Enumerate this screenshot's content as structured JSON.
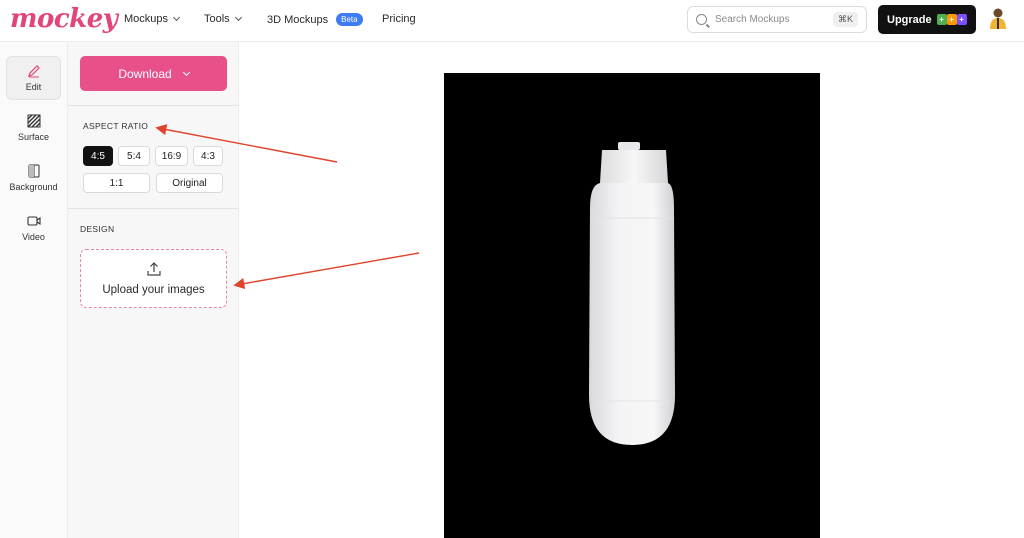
{
  "header": {
    "logo": "mockey",
    "nav": [
      {
        "label": "Mockups",
        "has_dropdown": true
      },
      {
        "label": "Tools",
        "has_dropdown": true
      },
      {
        "label": "3D Mockups",
        "badge": "Beta"
      },
      {
        "label": "Pricing"
      }
    ],
    "search": {
      "placeholder": "Search Mockups",
      "shortcut": "⌘K"
    },
    "upgrade_label": "Upgrade"
  },
  "rail": {
    "items": [
      {
        "label": "Edit",
        "icon": "pencil-icon",
        "active": true
      },
      {
        "label": "Surface",
        "icon": "texture-icon"
      },
      {
        "label": "Background",
        "icon": "background-icon"
      },
      {
        "label": "Video",
        "icon": "video-camera-icon"
      }
    ]
  },
  "panel": {
    "download_label": "Download",
    "aspect_ratio": {
      "title": "ASPECT RATIO",
      "options": [
        "4:5",
        "5:4",
        "16:9",
        "4:3",
        "1:1",
        "Original"
      ],
      "selected": "4:5"
    },
    "design": {
      "title": "DESIGN",
      "upload_label": "Upload your images"
    }
  },
  "colors": {
    "brand_pink": "#e8508a",
    "annotation_arrow": "#e0442c",
    "canvas_bg": "#000000"
  }
}
